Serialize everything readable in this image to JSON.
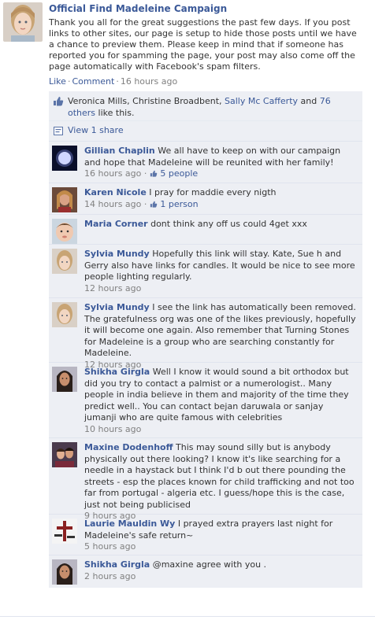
{
  "post": {
    "author": "Official Find Madeleine Campaign",
    "text": "Thank you all for the great suggestions the past few days. If you post links to other sites, our page is setup to hide those posts until we have a chance to preview them. Please keep in mind that if someone has reported you for spamming the page, your post may also come off the page automatically with Facebook's spam filters.",
    "like_label": "Like",
    "comment_label": "Comment",
    "time": "16 hours ago"
  },
  "likes": {
    "plain_names": "Veronica Mills, Christine Broadbent, ",
    "link_name": "Sally Mc Cafferty",
    "and_text": " and ",
    "others": "76 others",
    "suffix": " like this."
  },
  "view_share": "View 1 share",
  "comments": [
    {
      "name": "Gillian Chaplin",
      "text": "We all have to keep on with our campaign and hope that Madeleine will be reunited with her family!",
      "time": "16 hours ago",
      "likes": "5 people",
      "avatar": "moon-photo"
    },
    {
      "name": "Karen Nicole",
      "text": "I pray for maddie every nigth",
      "time": "14 hours ago",
      "likes": "1 person",
      "avatar": "woman-photo"
    },
    {
      "name": "Maria Corner",
      "text": "dont think any off us could 4get xxx",
      "time": "",
      "likes": "",
      "avatar": "baby-photo"
    },
    {
      "name": "Sylvia Mundy",
      "text": "Hopefully this link will stay. Kate, Sue h and Gerry also have links for candles. It would be nice to see more people lighting regularly.",
      "time": "12 hours ago",
      "likes": "",
      "avatar": "girl-photo"
    },
    {
      "name": "Sylvia Mundy",
      "text": "I see the link has automatically been removed. The gratefulness org was one of the likes previously, hopefully it will become one again. Also remember that Turning Stones for Madeleine is a group who are searching constantly for Madeleine.",
      "time": "12 hours ago",
      "likes": "",
      "avatar": "girl-photo"
    },
    {
      "name": "Shikha Girgla",
      "text": "Well I know it would sound a bit orthodox but did you try to contact a palmist or a numerologist.. Many people in india believe in them and majority of the time they predict well.. You can contact bejan daruwala or sanjay jumanji who are quite famous with celebrities",
      "time": "10 hours ago",
      "likes": "",
      "avatar": "woman-dark-photo"
    },
    {
      "name": "Maxine Dodenhoff",
      "text": "This may sound silly but is anybody physically out there looking? I know it's like searching for a needle in a haystack but I think I'd b out there pounding the streets - esp the places known for child trafficking and not too far from portugal - algeria etc. I guess/hope this is the case, just not being publicised",
      "time": "9 hours ago",
      "likes": "",
      "avatar": "couple-photo"
    },
    {
      "name": "Laurie Mauldin Wy",
      "text": "I prayed extra prayers last night for Madeleine's safe return~",
      "time": "5 hours ago",
      "likes": "",
      "avatar": "cross-photo"
    },
    {
      "name": "Shikha Girgla",
      "text": "@maxine agree with you .",
      "time": "2 hours ago",
      "likes": "",
      "avatar": "woman-dark-photo"
    }
  ],
  "colors": {
    "link": "#3b5998",
    "ufi_bg": "#edeff4",
    "meta": "#808080"
  }
}
